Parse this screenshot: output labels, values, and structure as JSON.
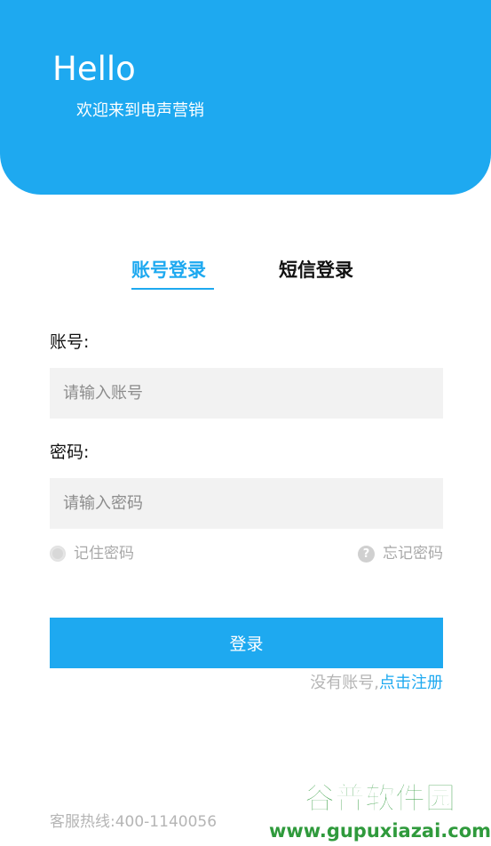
{
  "header": {
    "title": "Hello",
    "subtitle": "欢迎来到电声营销",
    "color": "#1ea9f0"
  },
  "tabs": [
    {
      "label": "账号登录",
      "active": true
    },
    {
      "label": "短信登录",
      "active": false
    }
  ],
  "form": {
    "account_label": "账号:",
    "account_placeholder": "请输入账号",
    "password_label": "密码:",
    "password_placeholder": "请输入密码",
    "remember_label": "记住密码",
    "forgot_label": "忘记密码",
    "login_button": "登录"
  },
  "register": {
    "prompt": "没有账号,",
    "link": "点击注册"
  },
  "footer": {
    "hotline": "客服热线:400-1140056"
  },
  "watermark": {
    "brand": "谷普软件园",
    "url": "www.gupuxiazai.com"
  },
  "icons": {
    "remember": "radio-icon",
    "forgot": "question-icon"
  }
}
